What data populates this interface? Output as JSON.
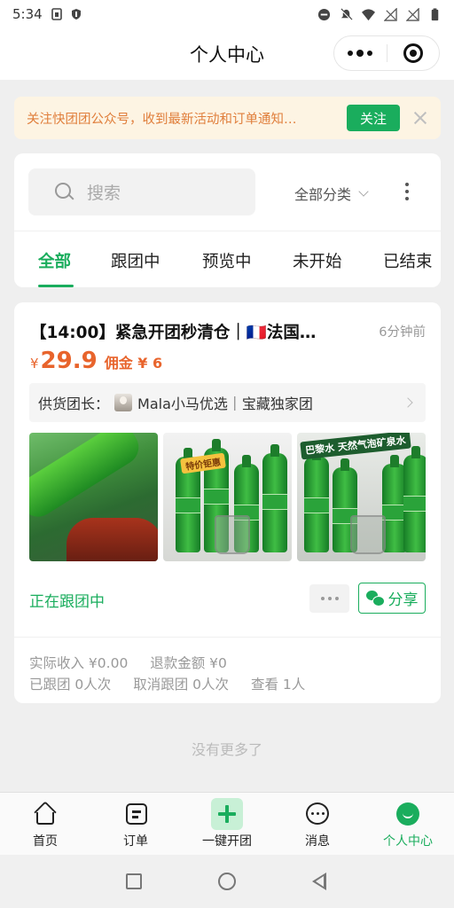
{
  "status_bar": {
    "time": "5:34"
  },
  "nav": {
    "title": "个人中心"
  },
  "notice": {
    "text": "关注快团团公众号，收到最新活动和订单通知…",
    "follow_label": "关注"
  },
  "search": {
    "placeholder": "搜索",
    "category_label": "全部分类"
  },
  "tabs": [
    {
      "label": "全部",
      "active": true
    },
    {
      "label": "跟团中",
      "active": false
    },
    {
      "label": "预览中",
      "active": false
    },
    {
      "label": "未开始",
      "active": false
    },
    {
      "label": "已结束",
      "active": false
    }
  ],
  "product": {
    "title": "【14:00】紧急开团秒清仓｜🇫🇷法国…",
    "time_ago": "6分钟前",
    "currency": "¥",
    "price": "29.9",
    "commission": "佣金 ¥ 6",
    "supplier_label": "供货团长：",
    "supplier_name": "Mala小马优选｜宝藏独家团",
    "image_tags": {
      "img2_tag": "特价钜惠",
      "img3_tag": "巴黎水 天然气泡矿泉水"
    },
    "status": "正在跟团中",
    "share_label": "分享",
    "stats": {
      "income": "实际收入 ¥0.00",
      "refund": "退款金额 ¥0",
      "followed": "已跟团 0人次",
      "canceled": "取消跟团 0人次",
      "views": "查看 1人"
    }
  },
  "no_more": "没有更多了",
  "tabbar": [
    {
      "label": "首页",
      "icon": "home-icon"
    },
    {
      "label": "订单",
      "icon": "order-icon"
    },
    {
      "label": "一键开团",
      "icon": "plus-icon"
    },
    {
      "label": "消息",
      "icon": "message-icon"
    },
    {
      "label": "个人中心",
      "icon": "profile-icon",
      "active": true
    }
  ],
  "colors": {
    "accent": "#1aad5d",
    "price": "#e8642c",
    "notice_text": "#e07e3b"
  }
}
